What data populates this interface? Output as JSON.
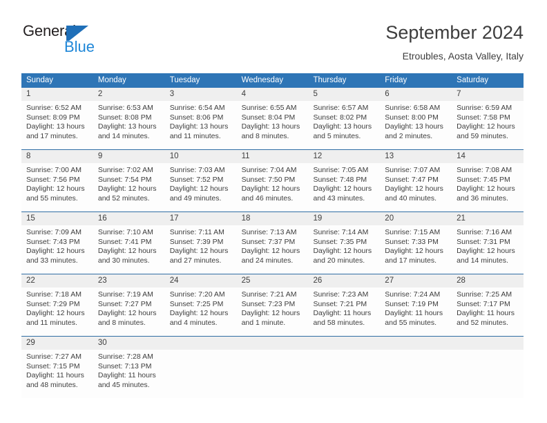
{
  "brand": {
    "name_part1": "General",
    "name_part2": "Blue",
    "mark": "triangle-logo"
  },
  "header": {
    "title": "September 2024",
    "subtitle": "Etroubles, Aosta Valley, Italy"
  },
  "colors": {
    "header_blue": "#2E75B6",
    "row_divider_blue": "#2E6DA4",
    "day_band_gray": "#EFEFEF",
    "brand_blue": "#1F87D8",
    "text": "#3D3D3D"
  },
  "weekday_headers": [
    "Sunday",
    "Monday",
    "Tuesday",
    "Wednesday",
    "Thursday",
    "Friday",
    "Saturday"
  ],
  "weeks": [
    [
      {
        "day": "1",
        "sunrise": "Sunrise: 6:52 AM",
        "sunset": "Sunset: 8:09 PM",
        "daylight_line1": "Daylight: 13 hours",
        "daylight_line2": "and 17 minutes."
      },
      {
        "day": "2",
        "sunrise": "Sunrise: 6:53 AM",
        "sunset": "Sunset: 8:08 PM",
        "daylight_line1": "Daylight: 13 hours",
        "daylight_line2": "and 14 minutes."
      },
      {
        "day": "3",
        "sunrise": "Sunrise: 6:54 AM",
        "sunset": "Sunset: 8:06 PM",
        "daylight_line1": "Daylight: 13 hours",
        "daylight_line2": "and 11 minutes."
      },
      {
        "day": "4",
        "sunrise": "Sunrise: 6:55 AM",
        "sunset": "Sunset: 8:04 PM",
        "daylight_line1": "Daylight: 13 hours",
        "daylight_line2": "and 8 minutes."
      },
      {
        "day": "5",
        "sunrise": "Sunrise: 6:57 AM",
        "sunset": "Sunset: 8:02 PM",
        "daylight_line1": "Daylight: 13 hours",
        "daylight_line2": "and 5 minutes."
      },
      {
        "day": "6",
        "sunrise": "Sunrise: 6:58 AM",
        "sunset": "Sunset: 8:00 PM",
        "daylight_line1": "Daylight: 13 hours",
        "daylight_line2": "and 2 minutes."
      },
      {
        "day": "7",
        "sunrise": "Sunrise: 6:59 AM",
        "sunset": "Sunset: 7:58 PM",
        "daylight_line1": "Daylight: 12 hours",
        "daylight_line2": "and 59 minutes."
      }
    ],
    [
      {
        "day": "8",
        "sunrise": "Sunrise: 7:00 AM",
        "sunset": "Sunset: 7:56 PM",
        "daylight_line1": "Daylight: 12 hours",
        "daylight_line2": "and 55 minutes."
      },
      {
        "day": "9",
        "sunrise": "Sunrise: 7:02 AM",
        "sunset": "Sunset: 7:54 PM",
        "daylight_line1": "Daylight: 12 hours",
        "daylight_line2": "and 52 minutes."
      },
      {
        "day": "10",
        "sunrise": "Sunrise: 7:03 AM",
        "sunset": "Sunset: 7:52 PM",
        "daylight_line1": "Daylight: 12 hours",
        "daylight_line2": "and 49 minutes."
      },
      {
        "day": "11",
        "sunrise": "Sunrise: 7:04 AM",
        "sunset": "Sunset: 7:50 PM",
        "daylight_line1": "Daylight: 12 hours",
        "daylight_line2": "and 46 minutes."
      },
      {
        "day": "12",
        "sunrise": "Sunrise: 7:05 AM",
        "sunset": "Sunset: 7:48 PM",
        "daylight_line1": "Daylight: 12 hours",
        "daylight_line2": "and 43 minutes."
      },
      {
        "day": "13",
        "sunrise": "Sunrise: 7:07 AM",
        "sunset": "Sunset: 7:47 PM",
        "daylight_line1": "Daylight: 12 hours",
        "daylight_line2": "and 40 minutes."
      },
      {
        "day": "14",
        "sunrise": "Sunrise: 7:08 AM",
        "sunset": "Sunset: 7:45 PM",
        "daylight_line1": "Daylight: 12 hours",
        "daylight_line2": "and 36 minutes."
      }
    ],
    [
      {
        "day": "15",
        "sunrise": "Sunrise: 7:09 AM",
        "sunset": "Sunset: 7:43 PM",
        "daylight_line1": "Daylight: 12 hours",
        "daylight_line2": "and 33 minutes."
      },
      {
        "day": "16",
        "sunrise": "Sunrise: 7:10 AM",
        "sunset": "Sunset: 7:41 PM",
        "daylight_line1": "Daylight: 12 hours",
        "daylight_line2": "and 30 minutes."
      },
      {
        "day": "17",
        "sunrise": "Sunrise: 7:11 AM",
        "sunset": "Sunset: 7:39 PM",
        "daylight_line1": "Daylight: 12 hours",
        "daylight_line2": "and 27 minutes."
      },
      {
        "day": "18",
        "sunrise": "Sunrise: 7:13 AM",
        "sunset": "Sunset: 7:37 PM",
        "daylight_line1": "Daylight: 12 hours",
        "daylight_line2": "and 24 minutes."
      },
      {
        "day": "19",
        "sunrise": "Sunrise: 7:14 AM",
        "sunset": "Sunset: 7:35 PM",
        "daylight_line1": "Daylight: 12 hours",
        "daylight_line2": "and 20 minutes."
      },
      {
        "day": "20",
        "sunrise": "Sunrise: 7:15 AM",
        "sunset": "Sunset: 7:33 PM",
        "daylight_line1": "Daylight: 12 hours",
        "daylight_line2": "and 17 minutes."
      },
      {
        "day": "21",
        "sunrise": "Sunrise: 7:16 AM",
        "sunset": "Sunset: 7:31 PM",
        "daylight_line1": "Daylight: 12 hours",
        "daylight_line2": "and 14 minutes."
      }
    ],
    [
      {
        "day": "22",
        "sunrise": "Sunrise: 7:18 AM",
        "sunset": "Sunset: 7:29 PM",
        "daylight_line1": "Daylight: 12 hours",
        "daylight_line2": "and 11 minutes."
      },
      {
        "day": "23",
        "sunrise": "Sunrise: 7:19 AM",
        "sunset": "Sunset: 7:27 PM",
        "daylight_line1": "Daylight: 12 hours",
        "daylight_line2": "and 8 minutes."
      },
      {
        "day": "24",
        "sunrise": "Sunrise: 7:20 AM",
        "sunset": "Sunset: 7:25 PM",
        "daylight_line1": "Daylight: 12 hours",
        "daylight_line2": "and 4 minutes."
      },
      {
        "day": "25",
        "sunrise": "Sunrise: 7:21 AM",
        "sunset": "Sunset: 7:23 PM",
        "daylight_line1": "Daylight: 12 hours",
        "daylight_line2": "and 1 minute."
      },
      {
        "day": "26",
        "sunrise": "Sunrise: 7:23 AM",
        "sunset": "Sunset: 7:21 PM",
        "daylight_line1": "Daylight: 11 hours",
        "daylight_line2": "and 58 minutes."
      },
      {
        "day": "27",
        "sunrise": "Sunrise: 7:24 AM",
        "sunset": "Sunset: 7:19 PM",
        "daylight_line1": "Daylight: 11 hours",
        "daylight_line2": "and 55 minutes."
      },
      {
        "day": "28",
        "sunrise": "Sunrise: 7:25 AM",
        "sunset": "Sunset: 7:17 PM",
        "daylight_line1": "Daylight: 11 hours",
        "daylight_line2": "and 52 minutes."
      }
    ],
    [
      {
        "day": "29",
        "sunrise": "Sunrise: 7:27 AM",
        "sunset": "Sunset: 7:15 PM",
        "daylight_line1": "Daylight: 11 hours",
        "daylight_line2": "and 48 minutes."
      },
      {
        "day": "30",
        "sunrise": "Sunrise: 7:28 AM",
        "sunset": "Sunset: 7:13 PM",
        "daylight_line1": "Daylight: 11 hours",
        "daylight_line2": "and 45 minutes."
      },
      {
        "day": "",
        "sunrise": "",
        "sunset": "",
        "daylight_line1": "",
        "daylight_line2": ""
      },
      {
        "day": "",
        "sunrise": "",
        "sunset": "",
        "daylight_line1": "",
        "daylight_line2": ""
      },
      {
        "day": "",
        "sunrise": "",
        "sunset": "",
        "daylight_line1": "",
        "daylight_line2": ""
      },
      {
        "day": "",
        "sunrise": "",
        "sunset": "",
        "daylight_line1": "",
        "daylight_line2": ""
      },
      {
        "day": "",
        "sunrise": "",
        "sunset": "",
        "daylight_line1": "",
        "daylight_line2": ""
      }
    ]
  ]
}
